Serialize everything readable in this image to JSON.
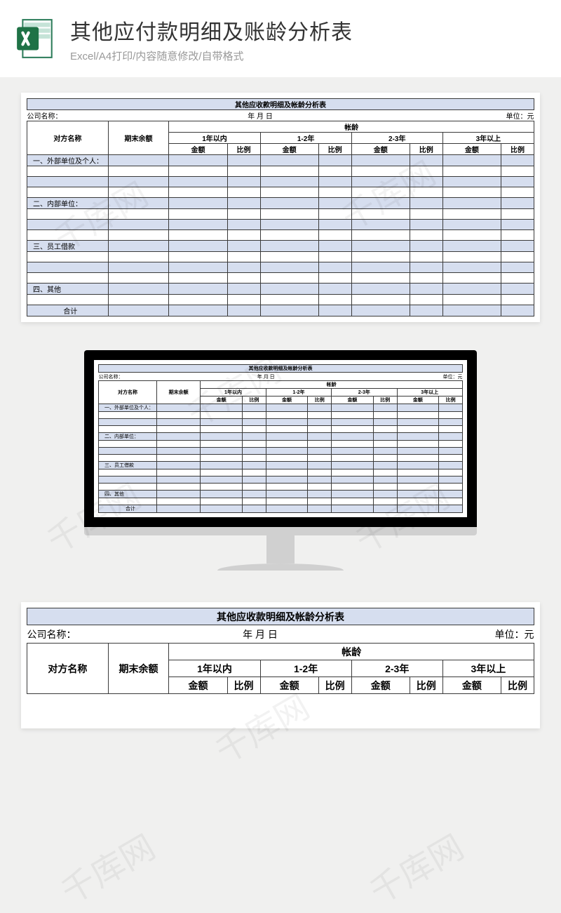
{
  "header": {
    "title": "其他应付款明细及账龄分析表",
    "subtitle": "Excel/A4打印/内容随意修改/自带格式"
  },
  "sheet": {
    "title": "其他应收款明细及帐龄分析表",
    "meta": {
      "company_label": "公司名称：",
      "date_label": "年  月  日",
      "unit_label": "单位：元"
    },
    "columns": {
      "party": "对方名称",
      "balance": "期末余额",
      "aging": "帐龄",
      "period1": "1年以内",
      "period2": "1-2年",
      "period3": "2-3年",
      "period4": "3年以上",
      "amount": "金额",
      "ratio": "比例"
    },
    "sections": {
      "s1": "一、外部单位及个人：",
      "s2": "二、内部单位：",
      "s3": "三、员工借款",
      "s4": "四、其他",
      "total": "合计"
    }
  },
  "watermark": "千库网"
}
